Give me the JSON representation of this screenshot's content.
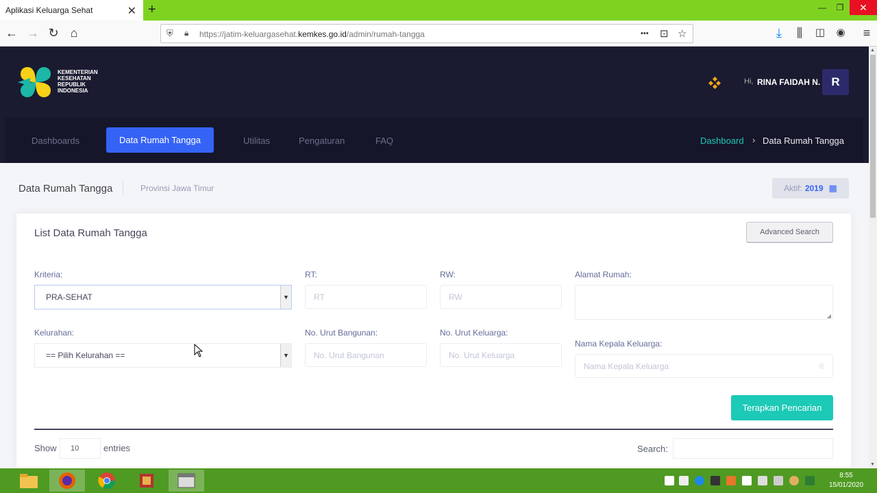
{
  "browser": {
    "tab_title": "Aplikasi Keluarga Sehat",
    "tab_close": "✕",
    "new_tab": "+",
    "url_prefix": "https://jatim-keluargasehat.",
    "url_domain": "kemkes.go.id",
    "url_path": "/admin/rumah-tangga",
    "more_icon": "•••"
  },
  "header": {
    "logo_lines": [
      "KEMENTERIAN",
      "KESEHATAN",
      "REPUBLIK",
      "INDONESIA"
    ],
    "greeting": "Hi,",
    "user_name": "RINA FAIDAH N.",
    "avatar_initial": "R"
  },
  "menu": {
    "items": [
      {
        "label": "Dashboards"
      },
      {
        "label": "Data Rumah Tangga"
      },
      {
        "label": "Utilitas"
      },
      {
        "label": "Pengaturan"
      },
      {
        "label": "FAQ"
      }
    ],
    "breadcrumb_link": "Dashboard",
    "breadcrumb_sep": "›",
    "breadcrumb_current": "Data Rumah Tangga"
  },
  "subheader": {
    "title": "Data Rumah Tangga",
    "description": "Provinsi Jawa Timur",
    "aktif_label": "Aktif:",
    "aktif_year": "2019"
  },
  "card": {
    "title": "List Data Rumah Tangga",
    "advanced_search": "Advanced Search",
    "kriteria_label": "Kriteria:",
    "kriteria_value": "PRA-SEHAT",
    "rt_label": "RT:",
    "rt_placeholder": "RT",
    "rw_label": "RW:",
    "rw_placeholder": "RW",
    "alamat_label": "Alamat Rumah:",
    "kelurahan_label": "Kelurahan:",
    "kelurahan_value": "== Pilih Kelurahan ==",
    "bangunan_label": "No. Urut Bangunan:",
    "bangunan_placeholder": "No. Urut Bangunan",
    "keluarga_label": "No. Urut Keluarga:",
    "keluarga_placeholder": "No. Urut Keluarga",
    "kepala_label": "Nama Kepala Keluarga:",
    "kepala_placeholder": "Nama Kepala Keluarga",
    "apply_button": "Terapkan Pencarian",
    "show_label": "Show",
    "entries_value": "10",
    "entries_label": "entries",
    "search_label": "Search:"
  },
  "taskbar": {
    "time": "8:55",
    "date": "15/01/2020"
  },
  "colors": {
    "accent": "#3563f6",
    "success": "#1dc9b7",
    "header_bg": "#1a1b30",
    "chrome_green": "#7ed321"
  }
}
